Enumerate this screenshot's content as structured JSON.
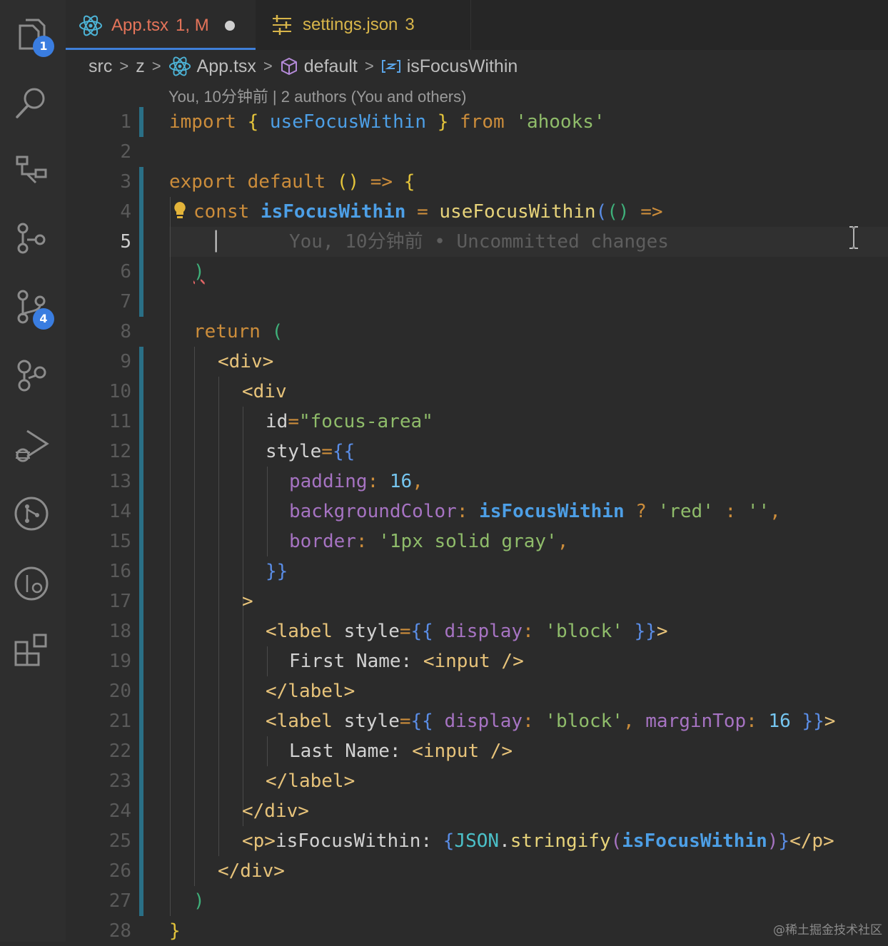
{
  "activity_bar": {
    "explorer_badge": "1",
    "source_control_badge": "4"
  },
  "tabs": [
    {
      "name": "App.tsx",
      "status": "1, M"
    },
    {
      "name": "settings.json",
      "status": "3"
    }
  ],
  "breadcrumb": {
    "items": [
      "src",
      "z",
      "App.tsx",
      "default",
      "isFocusWithin"
    ]
  },
  "blame": {
    "header": "You, 10分钟前 | 2 authors (You and others)",
    "inline": "You, 10分钟前 • Uncommitted changes"
  },
  "editor": {
    "active_line": "5",
    "line_numbers": [
      "1",
      "2",
      "3",
      "4",
      "5",
      "6",
      "7",
      "8",
      "9",
      "10",
      "11",
      "12",
      "13",
      "14",
      "15",
      "16",
      "17",
      "18",
      "19",
      "20",
      "21",
      "22",
      "23",
      "24",
      "25",
      "26",
      "27",
      "28"
    ]
  },
  "watermark": "@稀土掘金技术社区",
  "colors": {
    "accent": "#3f7fd8",
    "modified_tab": "#e5745a",
    "warning_tab": "#d8b54a"
  }
}
